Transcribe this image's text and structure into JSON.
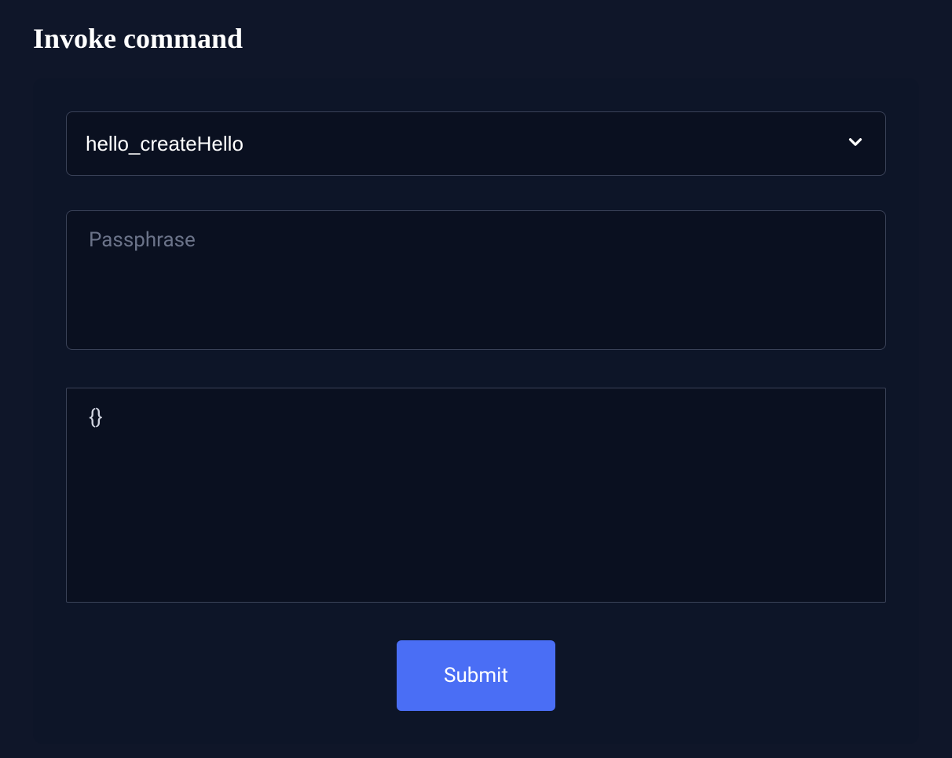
{
  "title": "Invoke command",
  "form": {
    "command_select": {
      "selected": "hello_createHello"
    },
    "passphrase": {
      "placeholder": "Passphrase",
      "value": ""
    },
    "payload": {
      "value": "{}"
    },
    "submit_label": "Submit"
  }
}
